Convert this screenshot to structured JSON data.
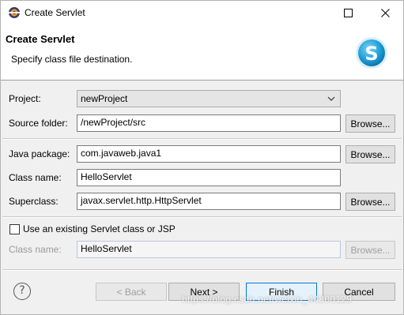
{
  "window": {
    "title": "Create Servlet"
  },
  "header": {
    "title": "Create Servlet",
    "description": "Specify class file destination."
  },
  "form": {
    "project_label": "Project:",
    "project_value": "newProject",
    "source_folder_label": "Source folder:",
    "source_folder_value": "/newProject/src",
    "java_package_label": "Java package:",
    "java_package_value": "com.javaweb.java1",
    "class_name_label": "Class name:",
    "class_name_value": "HelloServlet",
    "superclass_label": "Superclass:",
    "superclass_value": "javax.servlet.http.HttpServlet",
    "existing_checkbox_label": "Use an existing Servlet class or JSP",
    "existing_checkbox_checked": false,
    "existing_class_label": "Class name:",
    "existing_class_value": "HelloServlet",
    "browse_label": "Browse..."
  },
  "buttons": {
    "back": "< Back",
    "next": "Next >",
    "finish": "Finish",
    "cancel": "Cancel"
  },
  "watermark": "https://blog.csdn.net/weixin_44800129",
  "colors": {
    "accent": "#0078d7",
    "logo": "#1e9fd8"
  }
}
